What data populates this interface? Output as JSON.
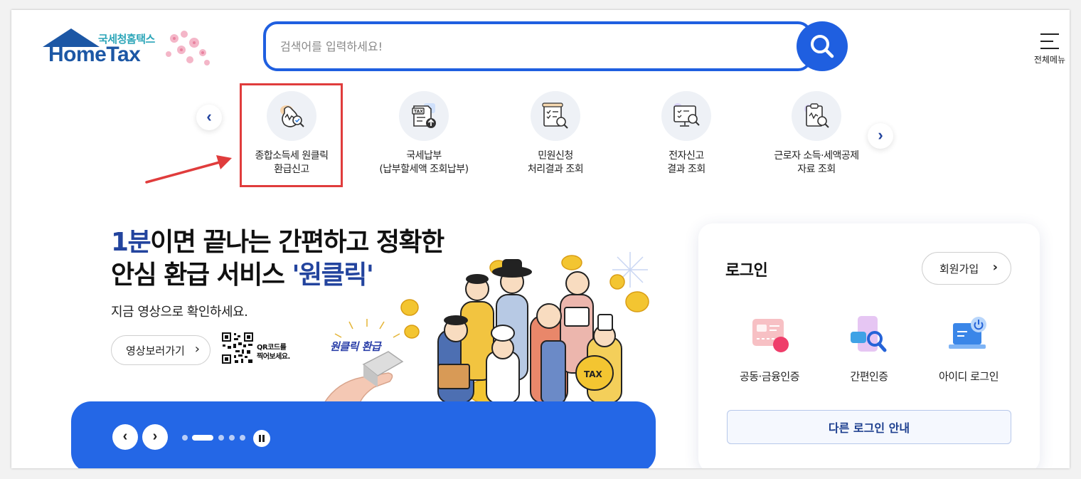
{
  "header": {
    "logo_ko": "국세청홈택스",
    "logo_en": "HomeTax",
    "search_placeholder": "검색어를 입력하세요!",
    "menu_label": "전체메뉴"
  },
  "quick_menu": {
    "items": [
      {
        "label": "종합소득세 원클릭\n환급신고",
        "icon": "money-bag-search-icon",
        "highlighted": true
      },
      {
        "label": "국세납부\n(납부할세액 조회납부)",
        "icon": "tax-document-upload-icon"
      },
      {
        "label": "민원신청\n처리결과 조회",
        "icon": "checklist-search-icon"
      },
      {
        "label": "전자신고\n결과 조회",
        "icon": "monitor-search-icon"
      },
      {
        "label": "근로자 소득·세액공제\n자료 조회",
        "icon": "clipboard-search-icon"
      }
    ],
    "prev_icon": "chevron-left-icon",
    "next_icon": "chevron-right-icon"
  },
  "banner": {
    "headline_highlight": "1분",
    "headline_line1_rest": "이면 끝나는 간편하고 정확한",
    "headline_line2_prefix": "안심 환급 서비스 ",
    "headline_line2_highlight": "'원클릭'",
    "subline": "지금 영상으로 확인하세요.",
    "video_button": "영상보러가기",
    "qr_text": "QR코드를\n찍어보세요.",
    "badge": "원클릭 환급",
    "illustration_tax": "TAX"
  },
  "slider": {
    "slide_count": 5,
    "active_index": 1
  },
  "login": {
    "title": "로그인",
    "signup_button": "회원가입",
    "options": [
      {
        "label": "공동·금융인증",
        "icon": "certificate-icon"
      },
      {
        "label": "간편인증",
        "icon": "phone-search-icon"
      },
      {
        "label": "아이디 로그인",
        "icon": "laptop-power-icon"
      }
    ],
    "other_login_button": "다른 로그인 안내"
  },
  "colors": {
    "brand_blue": "#1f5fe0",
    "navy": "#23449e",
    "highlight_red": "#e03c3c",
    "banner_blue": "#2467e6"
  }
}
